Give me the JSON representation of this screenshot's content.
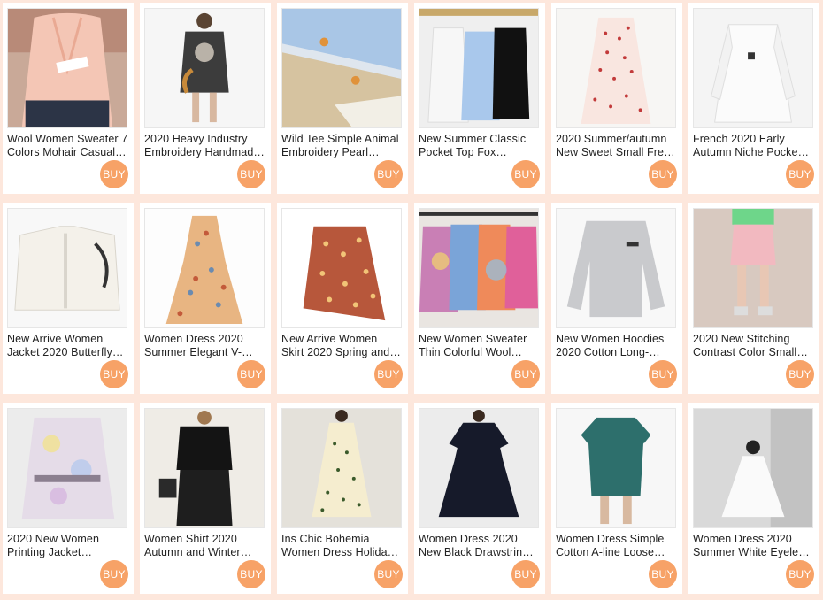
{
  "buy_label": "BUY",
  "accent_color": "#f7a267",
  "background_color": "#fde7dc",
  "products": [
    {
      "line1": "Wool Women Sweater 7",
      "line2": "Colors Mohair Casual…",
      "image": "pink-cardigan-photo"
    },
    {
      "line1": "2020 Heavy Industry",
      "line2": "Embroidery Handmad…",
      "image": "graphic-tee-dress-photo"
    },
    {
      "line1": "Wild Tee Simple Animal",
      "line2": "Embroidery Pearl…",
      "image": "folded-tees-photo"
    },
    {
      "line1": "New Summer Classic",
      "line2": "Pocket Top Fox…",
      "image": "three-tees-photo"
    },
    {
      "line1": "2020 Summer/autumn",
      "line2": "New Sweet Small Fre…",
      "image": "polka-dot-dress-photo"
    },
    {
      "line1": "French 2020 Early",
      "line2": "Autumn Niche Pocke…",
      "image": "white-shirt-photo"
    },
    {
      "line1": "New Arrive Women",
      "line2": "Jacket 2020 Butterfly…",
      "image": "white-denim-jacket-photo"
    },
    {
      "line1": "Women Dress 2020",
      "line2": "Summer Elegant V-…",
      "image": "floral-maxi-dress-photo"
    },
    {
      "line1": "New Arrive Women",
      "line2": "Skirt 2020 Spring and…",
      "image": "print-skirt-photo"
    },
    {
      "line1": "New Women Sweater",
      "line2": "Thin Colorful Wool…",
      "image": "tie-dye-sweaters-photo"
    },
    {
      "line1": "New Women Hoodies",
      "line2": "2020 Cotton Long-…",
      "image": "grey-sweatshirt-photo"
    },
    {
      "line1": "2020 New Stitching",
      "line2": "Contrast Color Small…",
      "image": "pink-shorts-photo"
    },
    {
      "line1": "2020 New Women",
      "line2": "Printing Jacket…",
      "image": "print-jacket-photo"
    },
    {
      "line1": "Women Shirt 2020",
      "line2": "Autumn and Winter…",
      "image": "black-outfit-photo"
    },
    {
      "line1": "Ins Chic Bohemia",
      "line2": "Women Dress Holida…",
      "image": "boho-dress-photo"
    },
    {
      "line1": "Women Dress 2020",
      "line2": "New Black Drawstrin…",
      "image": "black-dress-photo"
    },
    {
      "line1": "Women Dress Simple",
      "line2": "Cotton A-line Loose…",
      "image": "teal-dress-photo"
    },
    {
      "line1": "Women Dress 2020",
      "line2": "Summer White Eyele…",
      "image": "white-dress-photo"
    }
  ]
}
